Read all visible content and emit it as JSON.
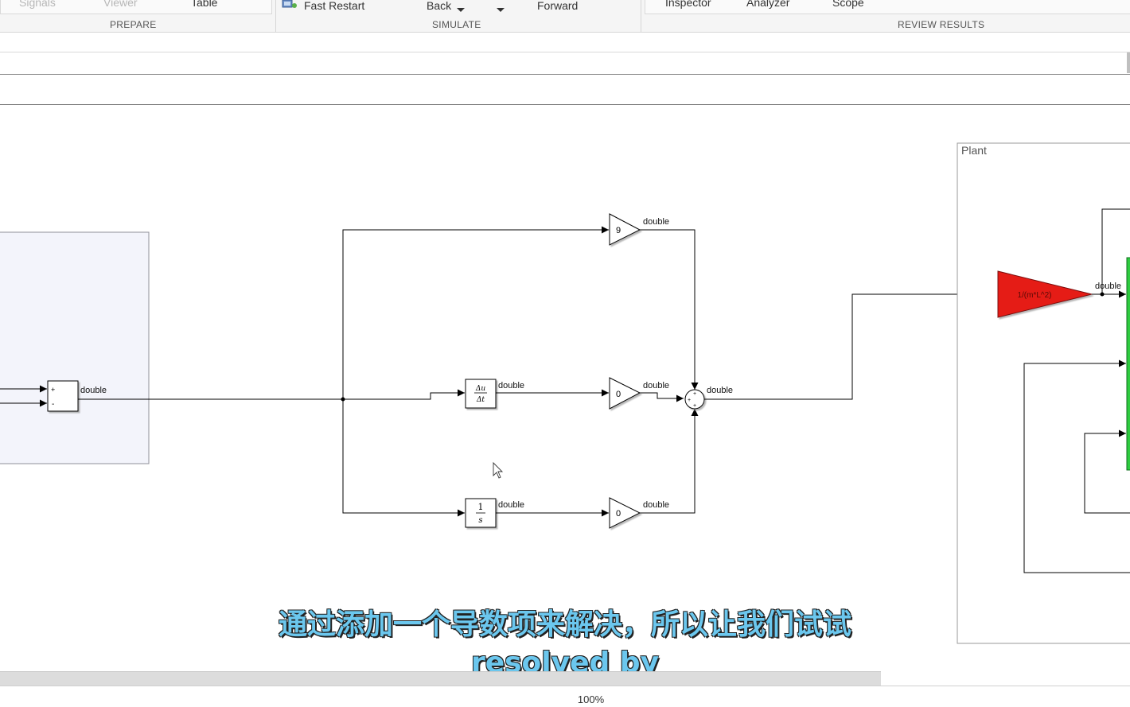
{
  "ribbon": {
    "prepare": {
      "label": "PREPARE",
      "signals": "Signals",
      "viewer": "Viewer",
      "table": "Table"
    },
    "simulate": {
      "label": "SIMULATE",
      "fast_restart": "Fast Restart",
      "step_back": "Back",
      "step_forward": "Forward"
    },
    "review": {
      "label": "REVIEW RESULTS",
      "inspector": "Inspector",
      "analyzer": "Analyzer",
      "scope": "Scope"
    }
  },
  "diagram": {
    "sum_left_plus": "+",
    "sum_left_minus": "-",
    "gain_p": "9",
    "gain_d": "0",
    "gain_i": "0",
    "deriv_num": "Δu",
    "deriv_den": "Δt",
    "integ_num": "1",
    "integ_den": "s",
    "sum_right_signs": "+ + +",
    "plant_label": "Plant",
    "plant_gain": "1/(m*L^2)",
    "sig_sum": "double",
    "sig_p": "double",
    "sig_deriv": "double",
    "sig_d": "double",
    "sig_integ": "double",
    "sig_i": "double",
    "sig_out": "double",
    "sig_plant_gain": "double",
    "colors": {
      "plant_gain_fill": "#e51b14",
      "integrator_bar": "#2ecc40",
      "subsystem_fill": "#f3f4fb"
    }
  },
  "subtitle": {
    "chinese": "通过添加一个导数项来解决，所以让我们试试",
    "english": "resolved by"
  },
  "status": {
    "zoom": "100%"
  }
}
